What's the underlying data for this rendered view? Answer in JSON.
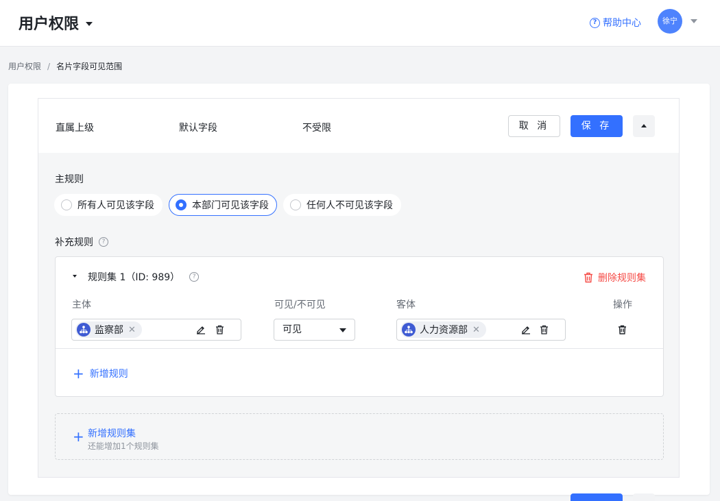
{
  "header": {
    "title": "用户权限",
    "help_label": "帮助中心",
    "help_icon_glyph": "?",
    "user_name": "徐宁"
  },
  "breadcrumb": {
    "root": "用户权限",
    "separator": "/",
    "current": "名片字段可见范围"
  },
  "field": {
    "name": "直属上级",
    "type": "默认字段",
    "range": "不受限",
    "cancel_label": "取 消",
    "save_label": "保 存"
  },
  "main_rule": {
    "title": "主规则",
    "options": [
      {
        "label": "所有人可见该字段",
        "selected": false
      },
      {
        "label": "本部门可见该字段",
        "selected": true
      },
      {
        "label": "任何人不可见该字段",
        "selected": false
      }
    ]
  },
  "supplement": {
    "title": "补充规则",
    "help_glyph": "?"
  },
  "ruleset": {
    "title": "规则集 1（ID: 989）",
    "delete_label": "删除规则集",
    "columns": {
      "subject": "主体",
      "visibility": "可见/不可见",
      "object": "客体",
      "action": "操作"
    },
    "rows": [
      {
        "subject": "监察部",
        "visibility": "可见",
        "object": "人力资源部"
      }
    ],
    "add_rule_label": "新增规则"
  },
  "add_ruleset": {
    "label": "新增规则集",
    "hint": "还能增加1个规则集"
  },
  "colors": {
    "primary": "#3370ff",
    "danger": "#f54a45",
    "org_icon": "#3f5bd3",
    "avatar": "#4e83fd"
  },
  "icons": {
    "header_caret": "caret-down",
    "help": "question-circle",
    "collapse": "caret-up",
    "delete": "trash",
    "edit": "pencil",
    "org": "org-tree",
    "tag_close": "×",
    "add": "+"
  }
}
